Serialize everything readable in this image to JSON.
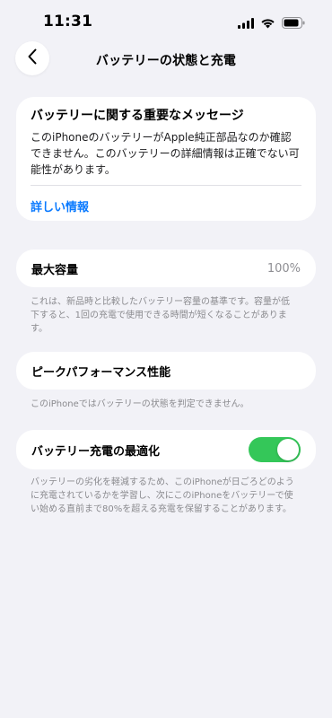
{
  "status_bar": {
    "time": "11:31",
    "icons": [
      "signal-icon",
      "wifi-icon",
      "battery-icon"
    ]
  },
  "nav": {
    "title": "バッテリーの状態と充電",
    "back_icon": "chevron-left-icon"
  },
  "message_card": {
    "title": "バッテリーに関する重要なメッセージ",
    "body": "このiPhoneのバッテリーがApple純正部品なのか確認できません。このバッテリーの詳細情報は正確でない可能性があります。",
    "link": "詳しい情報"
  },
  "max_capacity": {
    "label": "最大容量",
    "value": "100%",
    "footnote": "これは、新品時と比較したバッテリー容量の基準です。容量が低下すると、1回の充電で使用できる時間が短くなることがあります。"
  },
  "peak_performance": {
    "label": "ピークパフォーマンス性能",
    "footnote": "このiPhoneではバッテリーの状態を判定できません。"
  },
  "optimized_charging": {
    "label": "バッテリー充電の最適化",
    "enabled": true,
    "footnote": "バッテリーの劣化を軽減するため、このiPhoneが日ごろどのように充電されているかを学習し、次にこのiPhoneをバッテリーで使い始める直前まで80%を超える充電を保留することがあります。"
  },
  "colors": {
    "background": "#f2f2f7",
    "card": "#ffffff",
    "link": "#0a7aff",
    "toggle_on": "#34c759",
    "secondary_text": "#8e8e93"
  }
}
